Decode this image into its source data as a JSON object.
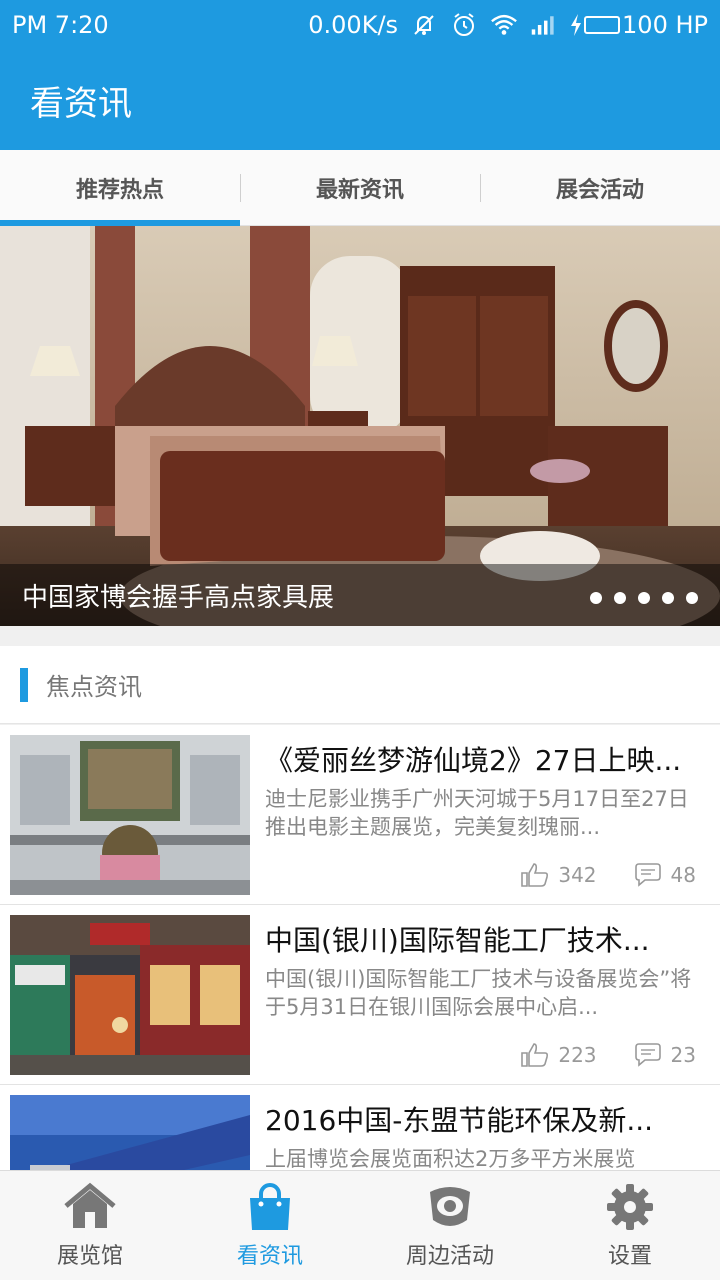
{
  "status_bar": {
    "time": "PM 7:20",
    "speed": "0.00K/s",
    "icons": [
      "mute-icon",
      "alarm-icon",
      "wifi-icon",
      "signal-icon",
      "charging-icon",
      "battery-icon"
    ],
    "battery": "100 HP"
  },
  "app_bar": {
    "title": "看资讯"
  },
  "tabs": [
    {
      "label": "推荐热点",
      "active": true
    },
    {
      "label": "最新资讯",
      "active": false
    },
    {
      "label": "展会活动",
      "active": false
    }
  ],
  "banner": {
    "caption": "中国家博会握手高点家具展",
    "page_count": 5,
    "active_page": 1
  },
  "focus_section": {
    "title": "焦点资讯"
  },
  "news": [
    {
      "title": "《爱丽丝梦游仙境2》27日上映...",
      "desc": "迪士尼影业携手广州天河城于5月17日至27日推出电影主题展览，完美复刻瑰丽...",
      "likes": "342",
      "comments": "48"
    },
    {
      "title": "中国(银川)国际智能工厂技术...",
      "desc": "中国(银川)国际智能工厂技术与设备展览会”将于5月31日在银川国际会展中心启...",
      "likes": "223",
      "comments": "23"
    },
    {
      "title": "2016中国-东盟节能环保及新...",
      "desc": "上届博览会展览面积达2万多平方米展览",
      "likes": "",
      "comments": ""
    }
  ],
  "bottom_nav": [
    {
      "label": "展览馆",
      "icon": "home-icon",
      "active": false
    },
    {
      "label": "看资讯",
      "icon": "bag-icon",
      "active": true
    },
    {
      "label": "周边活动",
      "icon": "eye-icon",
      "active": false
    },
    {
      "label": "设置",
      "icon": "gear-icon",
      "active": false
    }
  ],
  "colors": {
    "accent": "#1e9ae0",
    "text_muted": "#888888"
  }
}
